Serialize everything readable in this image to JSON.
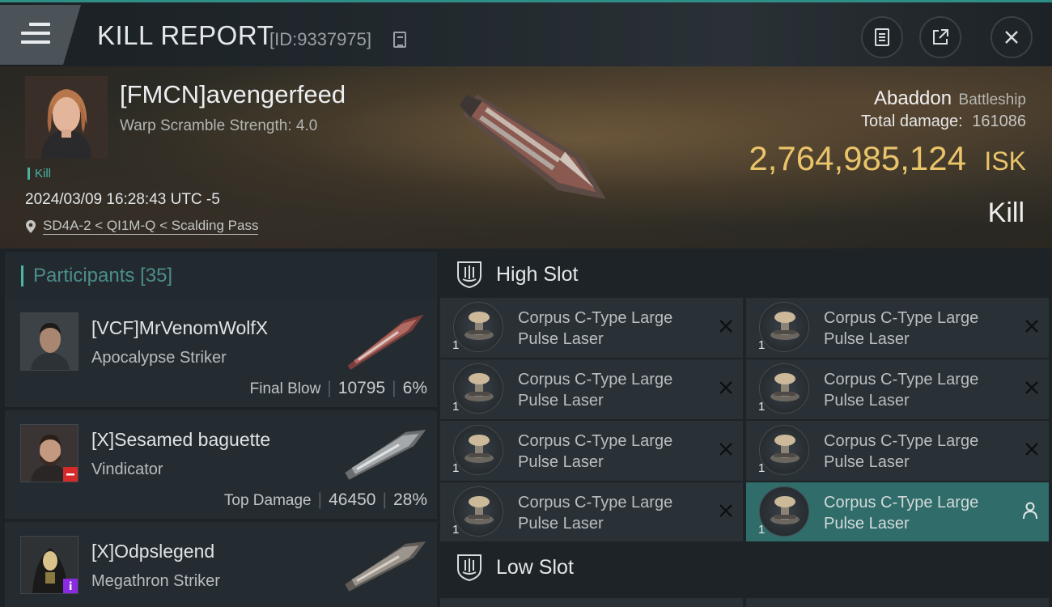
{
  "header": {
    "title": "KILL REPORT",
    "report_id": "[ID:9337975]"
  },
  "victim": {
    "name": "[FMCN]avengerfeed",
    "warp_scramble": "Warp Scramble Strength: 4.0",
    "kill_tag": "Kill",
    "date": "2024/03/09 16:28:43 UTC -5",
    "location": "SD4A-2 < QI1M-Q < Scalding Pass",
    "ship_name": "Abaddon",
    "ship_class": "Battleship",
    "total_damage_label": "Total damage:",
    "total_damage": "161086",
    "isk_value": "2,764,985,124",
    "isk_unit": "ISK",
    "result_label": "Kill"
  },
  "participants": {
    "title": "Participants",
    "count": "[35]",
    "rows": [
      {
        "name": "[VCF]MrVenomWolfX",
        "ship": "Apocalypse Striker",
        "label": "Final Blow",
        "damage": "10795",
        "percent": "6%"
      },
      {
        "name": "[X]Sesamed baguette",
        "ship": "Vindicator",
        "label": "Top Damage",
        "damage": "46450",
        "percent": "28%"
      },
      {
        "name": "[X]Odpslegend",
        "ship": "Megathron Striker",
        "label": "",
        "damage": "",
        "percent": ""
      }
    ]
  },
  "slots": {
    "high_title": "High Slot",
    "low_title": "Low Slot",
    "high_items": [
      {
        "line1": "Corpus C-Type Large",
        "line2": "Pulse Laser",
        "qty": "1"
      },
      {
        "line1": "Corpus C-Type Large",
        "line2": "Pulse Laser",
        "qty": "1"
      },
      {
        "line1": "Corpus C-Type Large",
        "line2": "Pulse Laser",
        "qty": "1"
      },
      {
        "line1": "Corpus C-Type Large",
        "line2": "Pulse Laser",
        "qty": "1"
      },
      {
        "line1": "Corpus C-Type Large",
        "line2": "Pulse Laser",
        "qty": "1"
      },
      {
        "line1": "Corpus C-Type Large",
        "line2": "Pulse Laser",
        "qty": "1"
      },
      {
        "line1": "Corpus C-Type Large",
        "line2": "Pulse Laser",
        "qty": "1"
      },
      {
        "line1": "Corpus C-Type Large",
        "line2": "Pulse Laser",
        "qty": "1"
      }
    ]
  },
  "colors": {
    "accent_teal": "#48b3a5",
    "isk_gold": "#e9c46a",
    "badge_red": "#d62a2a",
    "badge_purple": "#8a2be2"
  },
  "icons": {
    "menu": "menu-icon",
    "copy": "copy-icon",
    "clipboard": "clipboard-icon",
    "share": "share-icon",
    "close": "close-icon",
    "location": "location-pin-icon",
    "slot": "high-slot-icon"
  }
}
